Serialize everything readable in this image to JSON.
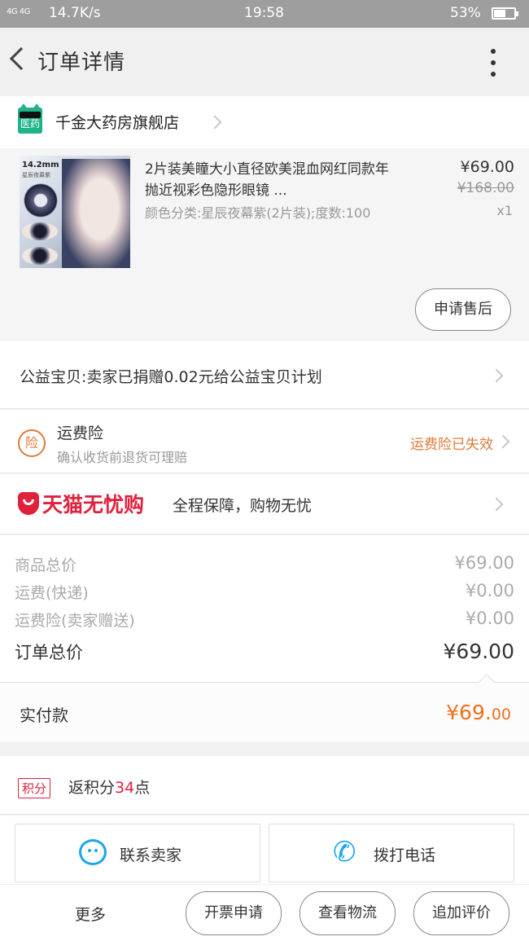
{
  "status_bar": {
    "signal": "4G 4G",
    "speed": "14.7K/s",
    "time": "19:58",
    "battery": "53%"
  },
  "header": {
    "title": "订单详情"
  },
  "shop": {
    "badge": "医药",
    "name": "千金大药房旗舰店"
  },
  "product": {
    "title": "2片装美瞳大小直径欧美混血网红同款年抛近视彩色隐形眼镜 ...",
    "sku": "颜色分类:星辰夜幕紫(2片装);度数:100",
    "price": "¥69.00",
    "original_price": "¥168.00",
    "quantity": "x1",
    "image_label": "14.2mm",
    "image_sublabel": "星辰夜幕紫",
    "after_sale_label": "申请售后"
  },
  "charity": {
    "text": "公益宝贝:卖家已捐赠0.02元给公益宝贝计划"
  },
  "freight_insurance": {
    "badge": "险",
    "title": "运费险",
    "subtitle": "确认收货前退货可理赔",
    "status": "运费险已失效"
  },
  "tmall": {
    "brand": "天猫无忧购",
    "slogan": "全程保障，购物无忧"
  },
  "summary": {
    "lines": [
      {
        "label": "商品总价",
        "value": "¥69.00"
      },
      {
        "label": "运费(快递)",
        "value": "¥0.00"
      },
      {
        "label": "运费险(卖家赠送)",
        "value": "¥0.00"
      }
    ],
    "total_label": "订单总价",
    "total_value": "¥69.00"
  },
  "payment": {
    "label": "实付款",
    "amount_main": "¥69.",
    "amount_cents": "00"
  },
  "points": {
    "badge": "积分",
    "prefix": "返积分",
    "number": "34",
    "suffix": "点"
  },
  "contact": {
    "seller_label": "联系卖家",
    "phone_label": "拨打电话"
  },
  "bottom": {
    "more": "更多",
    "invoice": "开票申请",
    "logistics": "查看物流",
    "review": "追加评价"
  },
  "colors": {
    "accent_orange": "#f0701a",
    "tmall_red": "#e0213d",
    "link_blue": "#1ba5f0",
    "pharmacy_green": "#1fb389"
  }
}
